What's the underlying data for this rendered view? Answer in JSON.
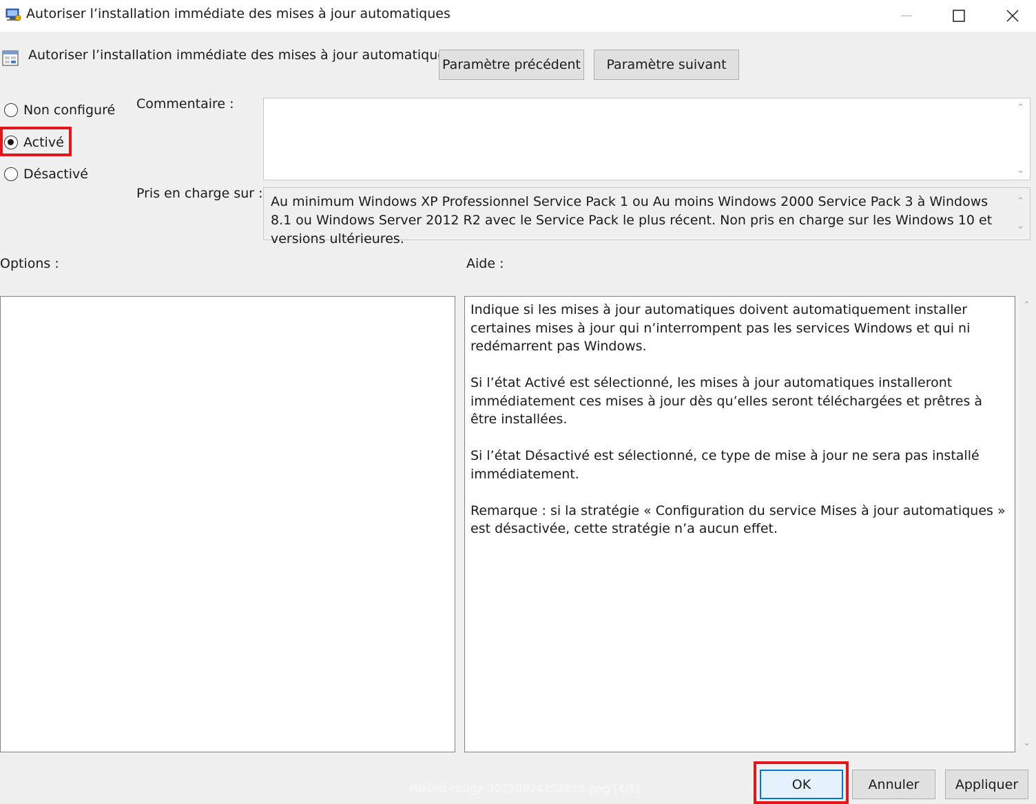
{
  "window": {
    "title": "Autoriser l’installation immédiate des mises à jour automatiques",
    "controls": [
      "minimize-icon",
      "maximize-icon",
      "close-icon"
    ]
  },
  "header": {
    "policy_name": "Autoriser l’installation immédiate des mises à jour automatiques",
    "prev_button": "Paramètre précédent",
    "next_button": "Paramètre suivant"
  },
  "state": {
    "options": [
      {
        "label": "Non configuré",
        "checked": false
      },
      {
        "label": "Activé",
        "checked": true
      },
      {
        "label": "Désactivé",
        "checked": false
      }
    ]
  },
  "comment": {
    "label": "Commentaire :",
    "value": ""
  },
  "supported": {
    "label": "Pris en charge sur :",
    "text": "Au minimum Windows XP Professionnel Service Pack 1 ou Au moins Windows 2000 Service Pack 3 à Windows 8.1 ou Windows Server 2012 R2 avec le Service Pack le plus récent. Non pris en charge sur les Windows 10 et versions ultérieures."
  },
  "options_section": {
    "label": "Options :"
  },
  "help": {
    "label": "Aide :",
    "paragraphs": [
      "Indique si les mises à jour automatiques doivent automatiquement installer certaines mises à jour qui n’interrompent pas les services Windows et qui ni redémarrent pas Windows.",
      "Si l’état Activé est sélectionné, les mises à jour automatiques installeront immédiatement ces mises à jour dès qu’elles seront téléchargées et prêtres à être installées.",
      "Si l’état Désactivé est sélectionné, ce type de mise à jour ne sera pas installé immédiatement.",
      "Remarque : si la stratégie « Configuration du service Mises à jour automatiques » est désactivée, cette stratégie n’a aucun effet."
    ]
  },
  "footer": {
    "ok": "OK",
    "cancel": "Annuler",
    "apply": "Appliquer"
  },
  "watermark": "Pasted image 20250924152010.png [4/5]",
  "colors": {
    "highlight": "#e3161c",
    "focus": "#0078d7",
    "background": "#f0f0f0"
  }
}
